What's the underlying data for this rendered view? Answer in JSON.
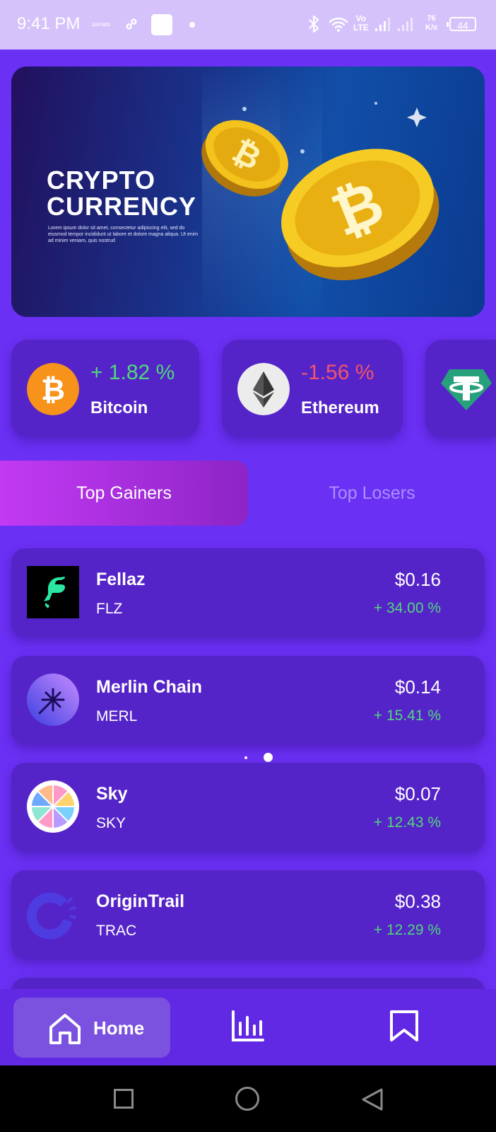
{
  "status_bar": {
    "time": "9:41 PM",
    "notification_app": "zomato",
    "network_type": "Vo LTE",
    "network_line1": "Vo",
    "network_line2": "LTE",
    "speed_value": "76",
    "speed_unit": "K/s",
    "battery": "44"
  },
  "banner": {
    "title_line1": "CRYPTO",
    "title_line2": "CURRENCY",
    "subtitle": "Lorem ipsum dolor sit amet, consectetur adipiscing elit, sed do eiusmod tempor incididunt ut labore et dolore magna aliqua. Ut enim ad minim veniam, quis nostrud"
  },
  "tickers": [
    {
      "name": "Bitcoin",
      "change": "+ 1.82 %",
      "icon": "bitcoin-icon",
      "change_color": "#4fd87a"
    },
    {
      "name": "Ethereum",
      "change": "-1.56 %",
      "icon": "ethereum-icon",
      "change_color": "#f0556b"
    },
    {
      "name": "",
      "change": "",
      "icon": "tether-icon"
    }
  ],
  "tabs": {
    "gainers": "Top Gainers",
    "losers": "Top Losers"
  },
  "coins": [
    {
      "name": "Fellaz",
      "symbol": "FLZ",
      "price": "$0.16",
      "change": "+ 34.00 %",
      "icon": "fellaz-icon"
    },
    {
      "name": "Merlin Chain",
      "symbol": "MERL",
      "price": "$0.14",
      "change": "+ 15.41 %",
      "icon": "merlin-chain-icon"
    },
    {
      "name": "Sky",
      "symbol": "SKY",
      "price": "$0.07",
      "change": "+ 12.43 %",
      "icon": "sky-icon"
    },
    {
      "name": "OriginTrail",
      "symbol": "TRAC",
      "price": "$0.38",
      "change": "+ 12.29 %",
      "icon": "origintrail-icon"
    }
  ],
  "bottom_nav": {
    "home_label": "Home"
  },
  "colors": {
    "background": "#6a30f3",
    "card": "#5524c8",
    "positive": "#4fd87a",
    "negative": "#f0556b",
    "tab_active_start": "#c23af3",
    "tab_active_end": "#8d24c6"
  }
}
